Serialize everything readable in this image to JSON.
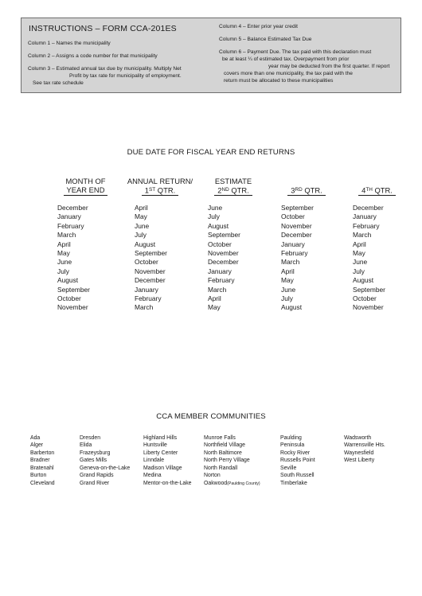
{
  "instructions": {
    "title": "INSTRUCTIONS – FORM CCA-201ES",
    "left_column": {
      "col1": "Column 1 – Names the municipality",
      "col2": "Column 2 – Assigns a code number for that municipality",
      "col3_line1": "Column 3 – Estimated annual tax due by municipality. Multiply Net",
      "col3_line2": "Profit by tax rate for municipality of employment.",
      "col3_line3": "See tax rate schedule"
    },
    "right_column": {
      "col4": "Column 4 – Enter prior year credit",
      "col5": "Column 5 – Balance Estimated Tax Due",
      "col6_line1": "Column 6 – Payment Due. The tax paid with this declaration must",
      "col6_line2": "be at least ¼ of estimated tax. Overpayment from prior",
      "col6_line3": "year may be deducted from the first quarter. If report",
      "col6_line4": "covers more than one municipality, the tax paid with the",
      "col6_line5": "return must be allocated to these municipalities"
    }
  },
  "fiscal": {
    "title": "DUE DATE FOR FISCAL YEAR END RETURNS",
    "headers": [
      {
        "line1": "MONTH OF",
        "line2": "YEAR END",
        "ordinal": "",
        "ordinal_rest": ""
      },
      {
        "line1": "ANNUAL",
        "line2": "RETURN/",
        "ordinal": "1",
        "ordinal_sup": "ST",
        "ordinal_rest": "QTR."
      },
      {
        "line1": "",
        "line2": "ESTIMATE",
        "ordinal": "2",
        "ordinal_sup": "ND",
        "ordinal_rest": "QTR."
      },
      {
        "line1": "",
        "line2": "",
        "ordinal": "3",
        "ordinal_sup": "RD",
        "ordinal_rest": "QTR."
      },
      {
        "line1": "",
        "line2": "",
        "ordinal": "4",
        "ordinal_sup": "TH",
        "ordinal_rest": "QTR."
      }
    ],
    "month_of_year_end": [
      "December",
      "January",
      "February",
      "March",
      "April",
      "May",
      "June",
      "July",
      "August",
      "September",
      "October",
      "November"
    ],
    "annual_return_q1": [
      "April",
      "May",
      "June",
      "July",
      "August",
      "September",
      "October",
      "November",
      "December",
      "January",
      "February",
      "March"
    ],
    "estimate_q2": [
      "June",
      "July",
      "August",
      "September",
      "October",
      "November",
      "December",
      "January",
      "February",
      "March",
      "April",
      "May"
    ],
    "q3": [
      "September",
      "October",
      "November",
      "December",
      "January",
      "February",
      "March",
      "April",
      "May",
      "June",
      "July",
      "August"
    ],
    "q4": [
      "December",
      "January",
      "February",
      "March",
      "April",
      "May",
      "June",
      "July",
      "August",
      "September",
      "October",
      "November"
    ]
  },
  "communities": {
    "title": "CCA MEMBER COMMUNITIES",
    "col1": [
      "Ada",
      "Alger",
      "Barberton",
      "Bradner",
      "Bratenahl",
      "Burton",
      "Cleveland"
    ],
    "col2": [
      "Dresden",
      "Elida",
      "Frazeysburg",
      "Gates Mills",
      "Geneva-on-the-Lake",
      "Grand Rapids",
      "Grand River"
    ],
    "col3": [
      "Highland Hills",
      "Huntsville",
      "Liberty Center",
      "Linndale",
      "Madison Village",
      "Medina",
      "Mentor-on-the-Lake"
    ],
    "col4": [
      "Munroe Falls",
      "Northfield Village",
      "North Baltimore",
      "North Perry Village",
      "North Randall",
      "Norton"
    ],
    "col4_last_main": "Oakwood",
    "col4_last_paren": "(Paulding County)",
    "col5": [
      "Paulding",
      "Peninsula",
      "Rocky River",
      "Russells Point",
      "Seville",
      "South Russell",
      "Timberlake"
    ],
    "col6": [
      "Wadsworth",
      "Warrensville Hts.",
      "Waynesfield",
      "West Liberty"
    ]
  },
  "colors": {
    "box_fill": "#d4d4d4",
    "box_border": "#6e6e6e",
    "text": "#1a1a1a",
    "page_bg": "#ffffff"
  }
}
